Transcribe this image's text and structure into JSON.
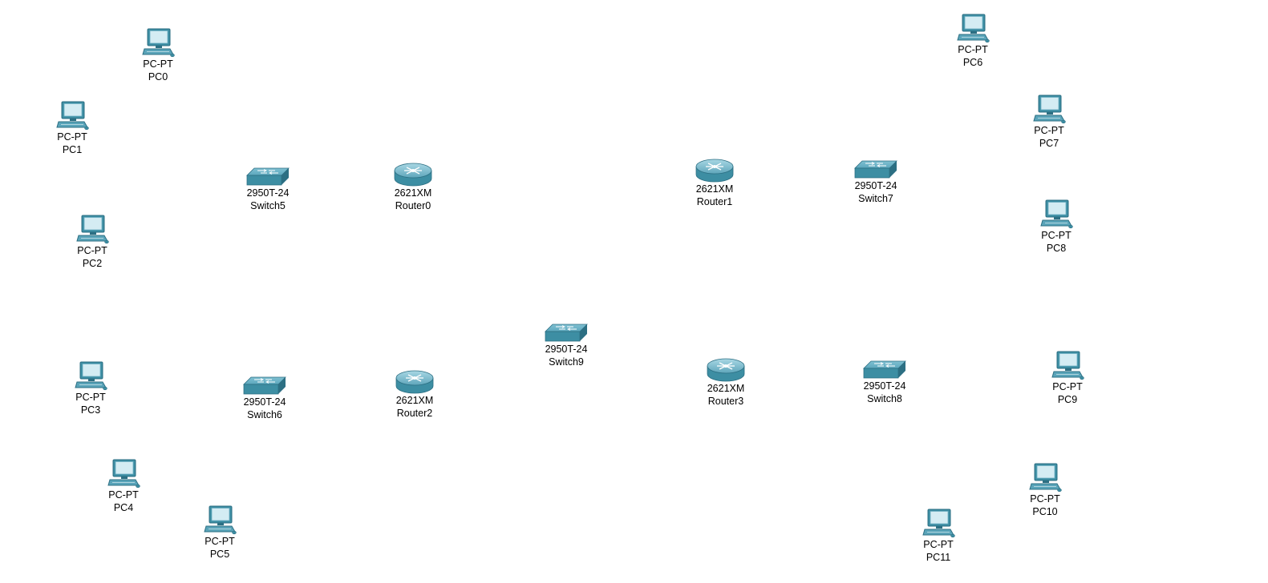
{
  "colors": {
    "background": "#ffffff",
    "device_teal": "#3d8ea3",
    "device_dark": "#2c6f83",
    "screen": "#cfe7ee"
  },
  "devices": [
    {
      "id": "pc0",
      "icon": "pc-icon",
      "model": "PC-PT",
      "name": "PC0"
    },
    {
      "id": "pc1",
      "icon": "pc-icon",
      "model": "PC-PT",
      "name": "PC1"
    },
    {
      "id": "pc2",
      "icon": "pc-icon",
      "model": "PC-PT",
      "name": "PC2"
    },
    {
      "id": "pc3",
      "icon": "pc-icon",
      "model": "PC-PT",
      "name": "PC3"
    },
    {
      "id": "pc4",
      "icon": "pc-icon",
      "model": "PC-PT",
      "name": "PC4"
    },
    {
      "id": "pc5",
      "icon": "pc-icon",
      "model": "PC-PT",
      "name": "PC5"
    },
    {
      "id": "pc6",
      "icon": "pc-icon",
      "model": "PC-PT",
      "name": "PC6"
    },
    {
      "id": "pc7",
      "icon": "pc-icon",
      "model": "PC-PT",
      "name": "PC7"
    },
    {
      "id": "pc8",
      "icon": "pc-icon",
      "model": "PC-PT",
      "name": "PC8"
    },
    {
      "id": "pc9",
      "icon": "pc-icon",
      "model": "PC-PT",
      "name": "PC9"
    },
    {
      "id": "pc10",
      "icon": "pc-icon",
      "model": "PC-PT",
      "name": "PC10"
    },
    {
      "id": "pc11",
      "icon": "pc-icon",
      "model": "PC-PT",
      "name": "PC11"
    },
    {
      "id": "switch5",
      "icon": "switch-icon",
      "model": "2950T-24",
      "name": "Switch5"
    },
    {
      "id": "switch6",
      "icon": "switch-icon",
      "model": "2950T-24",
      "name": "Switch6"
    },
    {
      "id": "switch7",
      "icon": "switch-icon",
      "model": "2950T-24",
      "name": "Switch7"
    },
    {
      "id": "switch8",
      "icon": "switch-icon",
      "model": "2950T-24",
      "name": "Switch8"
    },
    {
      "id": "switch9",
      "icon": "switch-icon",
      "model": "2950T-24",
      "name": "Switch9"
    },
    {
      "id": "router0",
      "icon": "router-icon",
      "model": "2621XM",
      "name": "Router0"
    },
    {
      "id": "router1",
      "icon": "router-icon",
      "model": "2621XM",
      "name": "Router1"
    },
    {
      "id": "router2",
      "icon": "router-icon",
      "model": "2621XM",
      "name": "Router2"
    },
    {
      "id": "router3",
      "icon": "router-icon",
      "model": "2621XM",
      "name": "Router3"
    }
  ]
}
